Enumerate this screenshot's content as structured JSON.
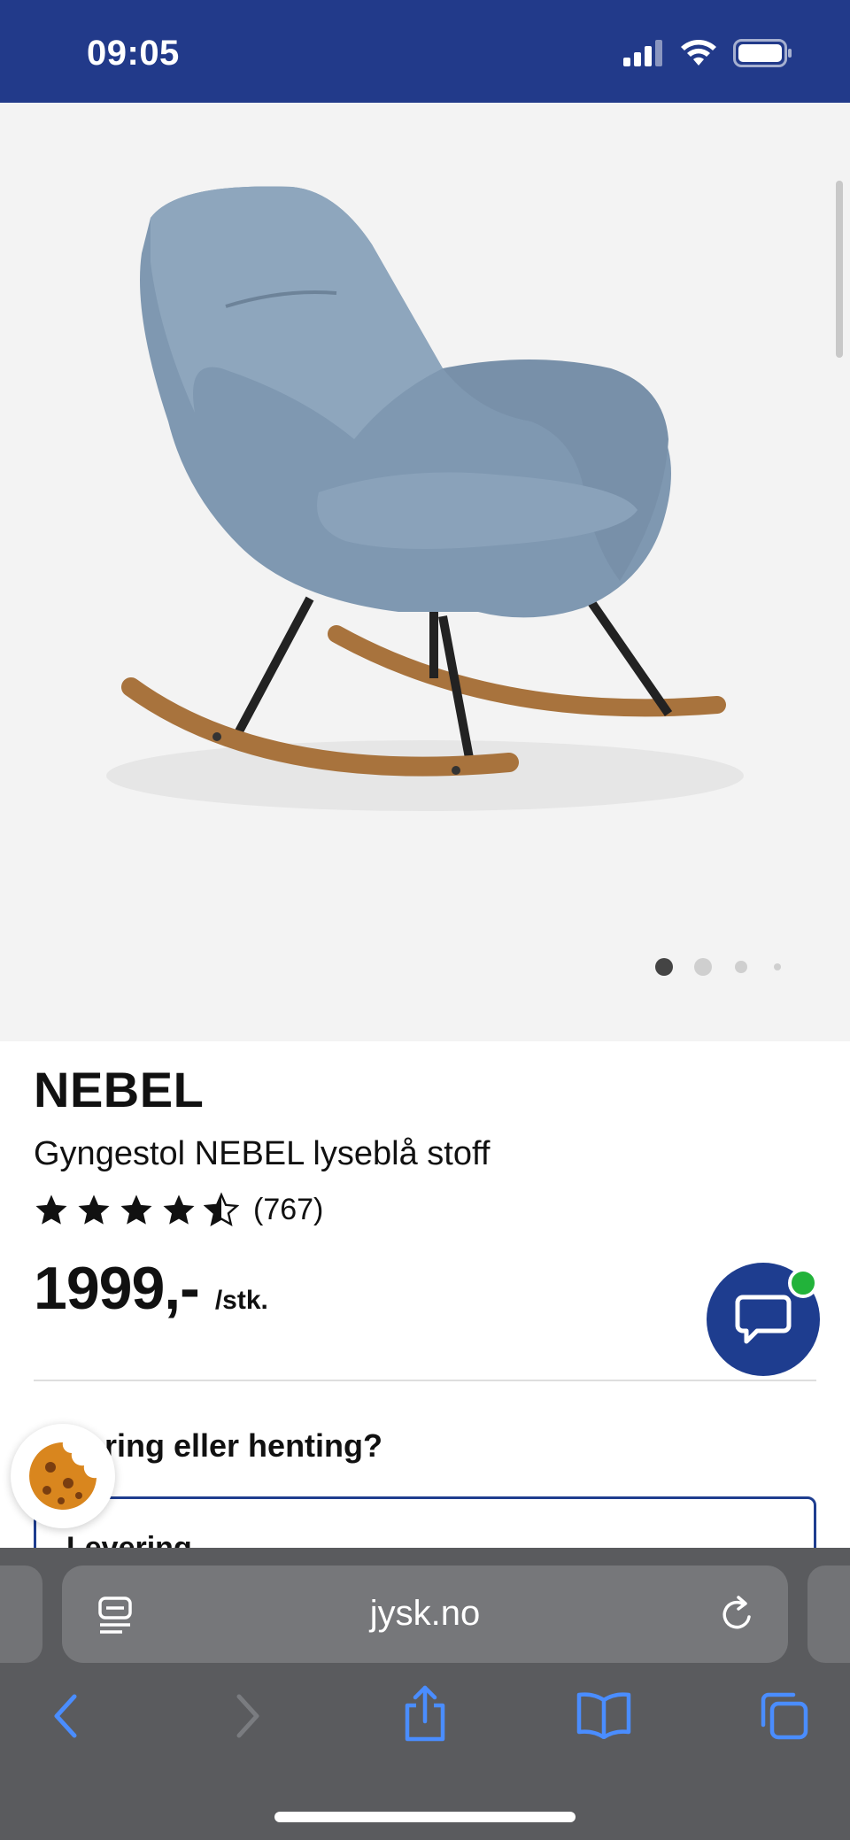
{
  "status_bar": {
    "time": "09:05"
  },
  "gallery": {
    "slide_count": 4,
    "active_index": 0
  },
  "product": {
    "brand": "NEBEL",
    "description": "Gyngestol NEBEL lyseblå stoff",
    "rating": 4.5,
    "review_count": "(767)",
    "price": "1999,-",
    "price_unit": "/stk."
  },
  "delivery": {
    "question": "Levering eller henting?",
    "question_visible": "ring eller henting?",
    "option_label": "Levering"
  },
  "browser": {
    "url": "jysk.no"
  },
  "colors": {
    "brand_blue": "#223a8a",
    "online_green": "#22b33a"
  },
  "icons": [
    "signal-icon",
    "wifi-icon",
    "battery-icon",
    "chat-icon",
    "cookie-icon",
    "reader-icon",
    "reload-icon",
    "back-icon",
    "forward-icon",
    "share-icon",
    "bookmarks-icon",
    "tabs-icon"
  ]
}
